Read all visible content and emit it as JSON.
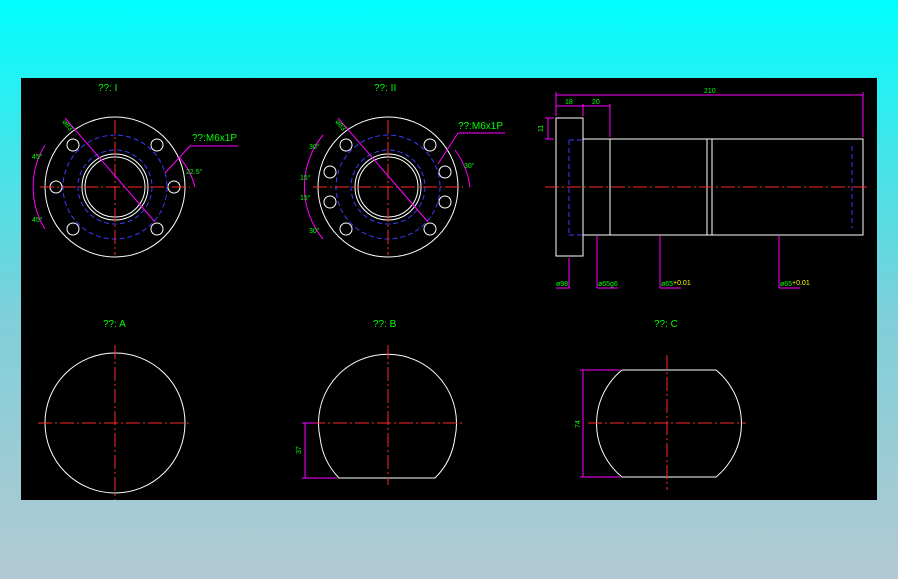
{
  "views": {
    "view1": {
      "title": "??: I",
      "dia_label": "ø83",
      "thread_label": "??:M6x1P",
      "angle_top": "45°",
      "angle_bottom": "45°",
      "angle_right": "22.5°"
    },
    "view2": {
      "title": "??: II",
      "dia_label": "ø83",
      "thread_label": "??:M6x1P",
      "angle_30_top": "30°",
      "angle_15_a": "15°",
      "angle_15_b": "15°",
      "angle_30_bottom": "30°",
      "angle_right": "30°"
    },
    "side": {
      "dim_total": "210",
      "dim_flange": "18",
      "dim_shoulder": "20",
      "dim_thickness": "11",
      "dia_flange": "ø98",
      "dia_spigot": "ø65g6",
      "dia_body1": "ø65",
      "dia_body2": "ø65"
    },
    "viewA": {
      "title": "??: A"
    },
    "viewB": {
      "title": "??: B",
      "dim": "37"
    },
    "viewC": {
      "title": "??: C",
      "dim": "74"
    }
  },
  "colors": {
    "background_gradient_top": "#00ffff",
    "background_gradient_bottom": "#b3c9d3",
    "drawing_area": "#000000",
    "outline": "#ffffff",
    "centerline": "#ff2a2a",
    "hidden_line": "#3b3bff",
    "dimension": "#ff00ff",
    "text": "#00ff00",
    "tolerance_text": "#ffff00"
  }
}
